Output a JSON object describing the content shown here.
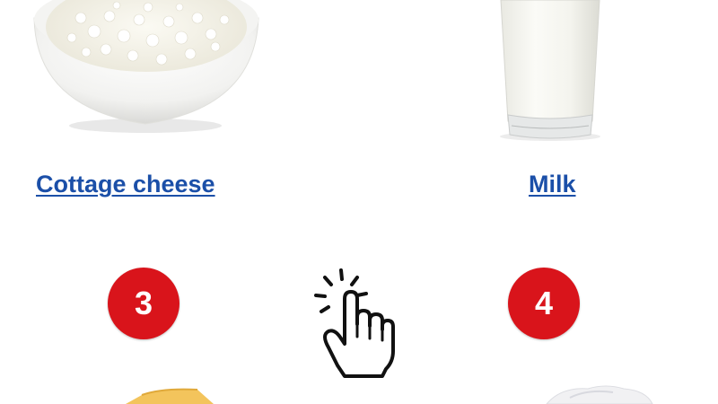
{
  "products": {
    "cottage_cheese": {
      "label": "Cottage cheese"
    },
    "milk": {
      "label": "Milk"
    }
  },
  "badges": {
    "third": {
      "number": "3"
    },
    "fourth": {
      "number": "4"
    }
  },
  "icons": {
    "pointer": "tap-hand-icon",
    "badge_color": "#d9141b",
    "link_color": "#1b4fa8"
  }
}
